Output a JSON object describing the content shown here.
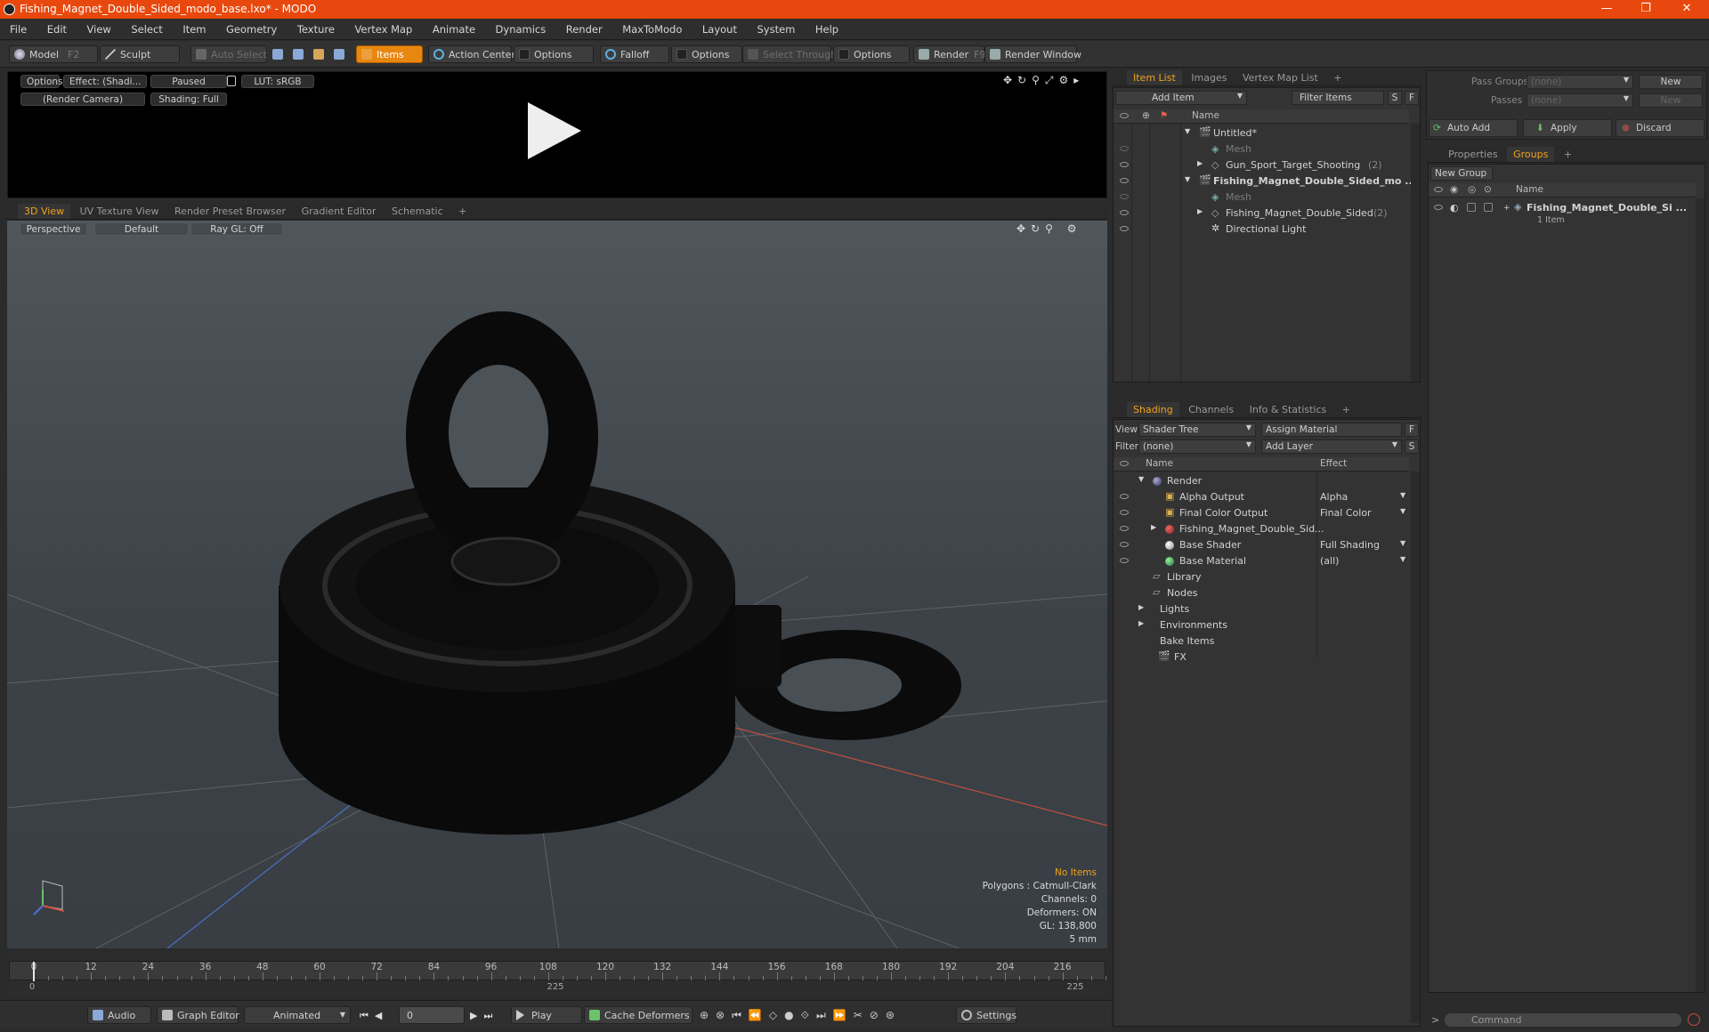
{
  "window": {
    "title": "Fishing_Magnet_Double_Sided_modo_base.lxo* - MODO",
    "minimize": "—",
    "maximize": "❐",
    "close": "✕"
  },
  "menu": [
    "File",
    "Edit",
    "View",
    "Select",
    "Item",
    "Geometry",
    "Texture",
    "Vertex Map",
    "Animate",
    "Dynamics",
    "Render",
    "MaxToModo",
    "Layout",
    "System",
    "Help"
  ],
  "toolbar": {
    "model": "Model",
    "model_key": "F2",
    "sculpt": "Sculpt",
    "auto_select": "Auto Select",
    "items": "Items",
    "action_center": "Action Center",
    "options1": "Options",
    "falloff": "Falloff",
    "options2": "Options",
    "select_through": "Select Through",
    "options3": "Options",
    "render": "Render",
    "render_key": "F9",
    "render_window": "Render Window"
  },
  "preview": {
    "options": "Options",
    "effect": "Effect: (Shadi...",
    "paused": "Paused",
    "lut": "LUT: sRGB",
    "camera": "(Render Camera)",
    "shading": "Shading: Full"
  },
  "viewport_tabs": [
    "3D View",
    "UV Texture View",
    "Render Preset Browser",
    "Gradient Editor",
    "Schematic",
    "+"
  ],
  "viewport": {
    "perspective": "Perspective",
    "default": "Default",
    "raygl": "Ray GL: Off",
    "info": {
      "no_items": "No Items",
      "polygons": "Polygons : Catmull-Clark",
      "channels": "Channels: 0",
      "deformers": "Deformers: ON",
      "gl": "GL: 138,800",
      "unit": "5 mm"
    }
  },
  "timeline": {
    "ticks": [
      "0",
      "12",
      "24",
      "36",
      "48",
      "60",
      "72",
      "84",
      "96",
      "108",
      "120",
      "132",
      "144",
      "156",
      "168",
      "180",
      "192",
      "204",
      "216"
    ],
    "bottom_labels": [
      "0",
      "225",
      "225"
    ]
  },
  "bottombar": {
    "audio": "Audio",
    "graph_editor": "Graph Editor",
    "animated": "Animated",
    "frame": "0",
    "play": "Play",
    "cache": "Cache Deformers",
    "settings": "Settings"
  },
  "item_list": {
    "tabs": [
      "Item List",
      "Images",
      "Vertex Map List",
      "+"
    ],
    "add_item": "Add Item",
    "filter": "Filter Items",
    "s": "S",
    "f": "F",
    "col_name": "Name",
    "rows": [
      {
        "label": "Untitled*",
        "count": ""
      },
      {
        "label": "Mesh",
        "count": ""
      },
      {
        "label": "Gun_Sport_Target_Shooting",
        "count": "(2)"
      },
      {
        "label": "Fishing_Magnet_Double_Sided_mo ...",
        "count": ""
      },
      {
        "label": "Mesh",
        "count": ""
      },
      {
        "label": "Fishing_Magnet_Double_Sided",
        "count": "(2)"
      },
      {
        "label": "Directional Light",
        "count": ""
      }
    ]
  },
  "shading": {
    "tabs": [
      "Shading",
      "Channels",
      "Info & Statistics",
      "+"
    ],
    "view_label": "View",
    "view_value": "Shader Tree",
    "assign": "Assign Material",
    "f": "F",
    "filter_label": "Filter",
    "filter_value": "(none)",
    "add_layer": "Add Layer",
    "s": "S",
    "col_name": "Name",
    "col_effect": "Effect",
    "rows": [
      {
        "label": "Render",
        "effect": ""
      },
      {
        "label": "Alpha Output",
        "effect": "Alpha"
      },
      {
        "label": "Final Color Output",
        "effect": "Final Color"
      },
      {
        "label": "Fishing_Magnet_Double_Sid...",
        "effect": ""
      },
      {
        "label": "Base Shader",
        "effect": "Full Shading"
      },
      {
        "label": "Base Material",
        "effect": "(all)"
      },
      {
        "label": "Library",
        "effect": ""
      },
      {
        "label": "Nodes",
        "effect": ""
      },
      {
        "label": "Lights",
        "effect": ""
      },
      {
        "label": "Environments",
        "effect": ""
      },
      {
        "label": "Bake Items",
        "effect": ""
      },
      {
        "label": "FX",
        "effect": ""
      }
    ]
  },
  "passes": {
    "pass_groups": "Pass Groups",
    "passes": "Passes",
    "none1": "(none)",
    "none2": "(none)",
    "new1": "New",
    "new2": "New",
    "auto_add": "Auto Add",
    "apply": "Apply",
    "discard": "Discard"
  },
  "groups": {
    "tabs": [
      "Properties",
      "Groups",
      "+"
    ],
    "new_group": "New Group",
    "col_name": "Name",
    "item": "Fishing_Magnet_Double_Si ...",
    "item_sub": "1 Item"
  },
  "command": {
    "placeholder": "Command",
    "arrow": ">"
  },
  "colors": {
    "accent": "#f0a21e",
    "titlebar": "#e8480d",
    "items_btn": "#e8870f"
  }
}
